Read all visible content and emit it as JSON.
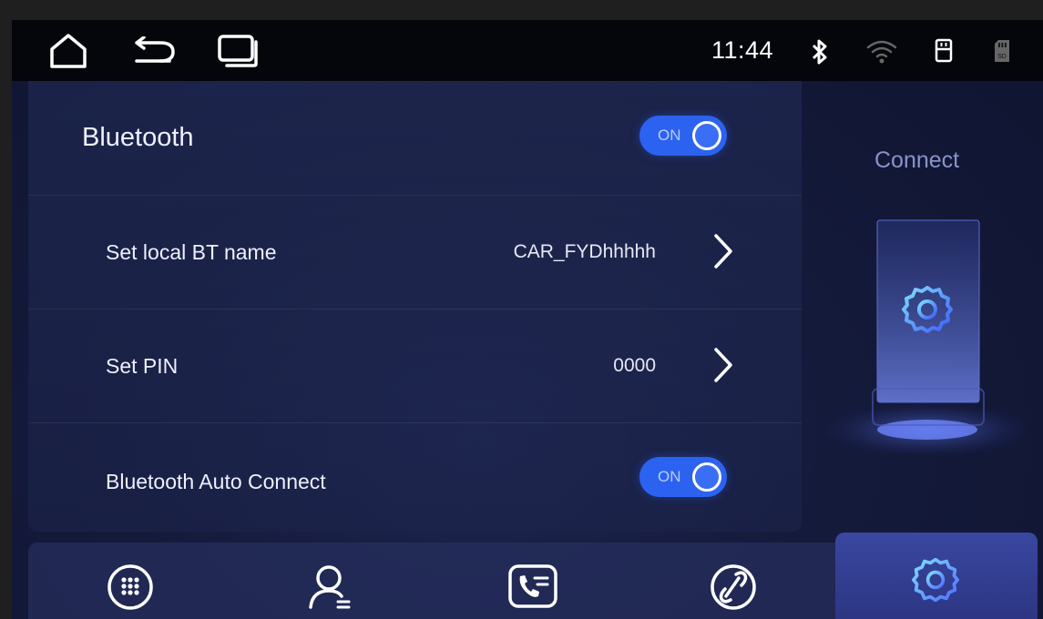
{
  "statusbar": {
    "time": "11:44",
    "icons": [
      "home-icon",
      "back-icon",
      "recent-apps-icon",
      "bluetooth-icon",
      "wifi-icon",
      "usb-drive-icon",
      "sd-card-icon"
    ]
  },
  "settings": {
    "bluetooth": {
      "label": "Bluetooth",
      "toggle": "ON"
    },
    "bt_name": {
      "label": "Set local BT name",
      "value": "CAR_FYDhhhhh"
    },
    "pin": {
      "label": "Set PIN",
      "value": "0000"
    },
    "auto_connect": {
      "label": "Bluetooth Auto Connect",
      "toggle": "ON"
    }
  },
  "side": {
    "title": "Connect"
  },
  "bottom_nav": [
    "dialpad-icon",
    "contacts-icon",
    "call-log-icon",
    "link-icon",
    "settings-icon"
  ],
  "colors": {
    "accent": "#2c62f0",
    "panel": "#1c2550",
    "active_tab": "#3a47a0"
  }
}
